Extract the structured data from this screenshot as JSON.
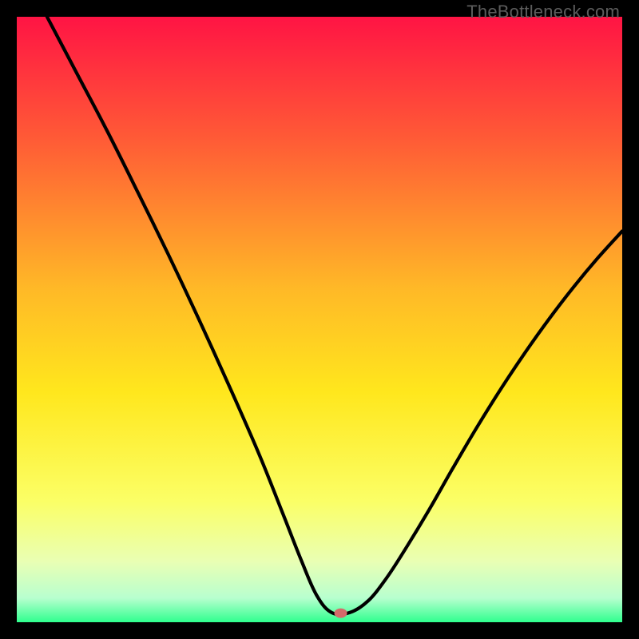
{
  "watermark": "TheBottleneck.com",
  "chart_data": {
    "type": "line",
    "title": "",
    "xlabel": "",
    "ylabel": "",
    "xlim": [
      0,
      100
    ],
    "ylim": [
      0,
      100
    ],
    "grid": false,
    "legend": false,
    "background_gradient_stops": [
      {
        "pct": 0,
        "color": "#ff1444"
      },
      {
        "pct": 20,
        "color": "#ff5a36"
      },
      {
        "pct": 45,
        "color": "#ffb927"
      },
      {
        "pct": 62,
        "color": "#ffe71d"
      },
      {
        "pct": 80,
        "color": "#fbff66"
      },
      {
        "pct": 90,
        "color": "#e9ffb4"
      },
      {
        "pct": 96,
        "color": "#b8ffcf"
      },
      {
        "pct": 100,
        "color": "#2fff8e"
      }
    ],
    "marker": {
      "x": 53.5,
      "y": 1.5,
      "color": "#d46a6a",
      "rx": 8,
      "ry": 6
    },
    "series": [
      {
        "name": "curve",
        "x": [
          5,
          10,
          15,
          20,
          25,
          30,
          35,
          40,
          44,
          47,
          49.5,
          52,
          55,
          58,
          61,
          64,
          68,
          72,
          76,
          80,
          84,
          88,
          92,
          96,
          100
        ],
        "y": [
          100,
          90.5,
          81,
          71,
          60.8,
          50.2,
          39.2,
          27.8,
          17.8,
          10.2,
          4.5,
          1.6,
          1.6,
          3.5,
          7.2,
          11.8,
          18.4,
          25.4,
          32.2,
          38.6,
          44.6,
          50.2,
          55.4,
          60.2,
          64.6
        ]
      }
    ]
  }
}
